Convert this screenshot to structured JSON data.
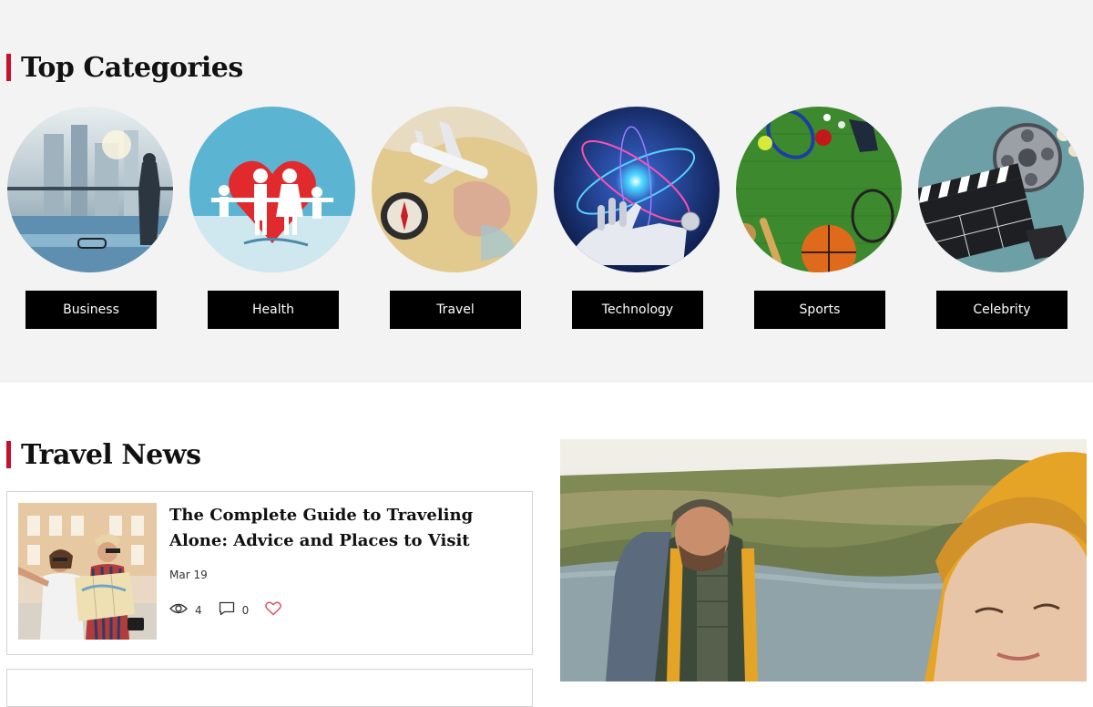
{
  "top_categories": {
    "title": "Top Categories",
    "items": [
      {
        "label": "Business",
        "icon": "business-office-image"
      },
      {
        "label": "Health",
        "icon": "health-family-heart-image"
      },
      {
        "label": "Travel",
        "icon": "travel-map-plane-image"
      },
      {
        "label": "Technology",
        "icon": "technology-robot-hand-image"
      },
      {
        "label": "Sports",
        "icon": "sports-balls-image"
      },
      {
        "label": "Celebrity",
        "icon": "celebrity-clapperboard-image"
      }
    ]
  },
  "travel_news": {
    "title": "Travel News",
    "articles": [
      {
        "title": "The Complete Guide to Traveling Alone: Advice and Places to Visit",
        "date": "Mar 19",
        "views": "4",
        "comments": "0"
      }
    ]
  },
  "colors": {
    "accent": "#c8102e",
    "label_bg": "#000000",
    "band_bg": "#f3f3f3",
    "like_heart": "#e0505f"
  }
}
